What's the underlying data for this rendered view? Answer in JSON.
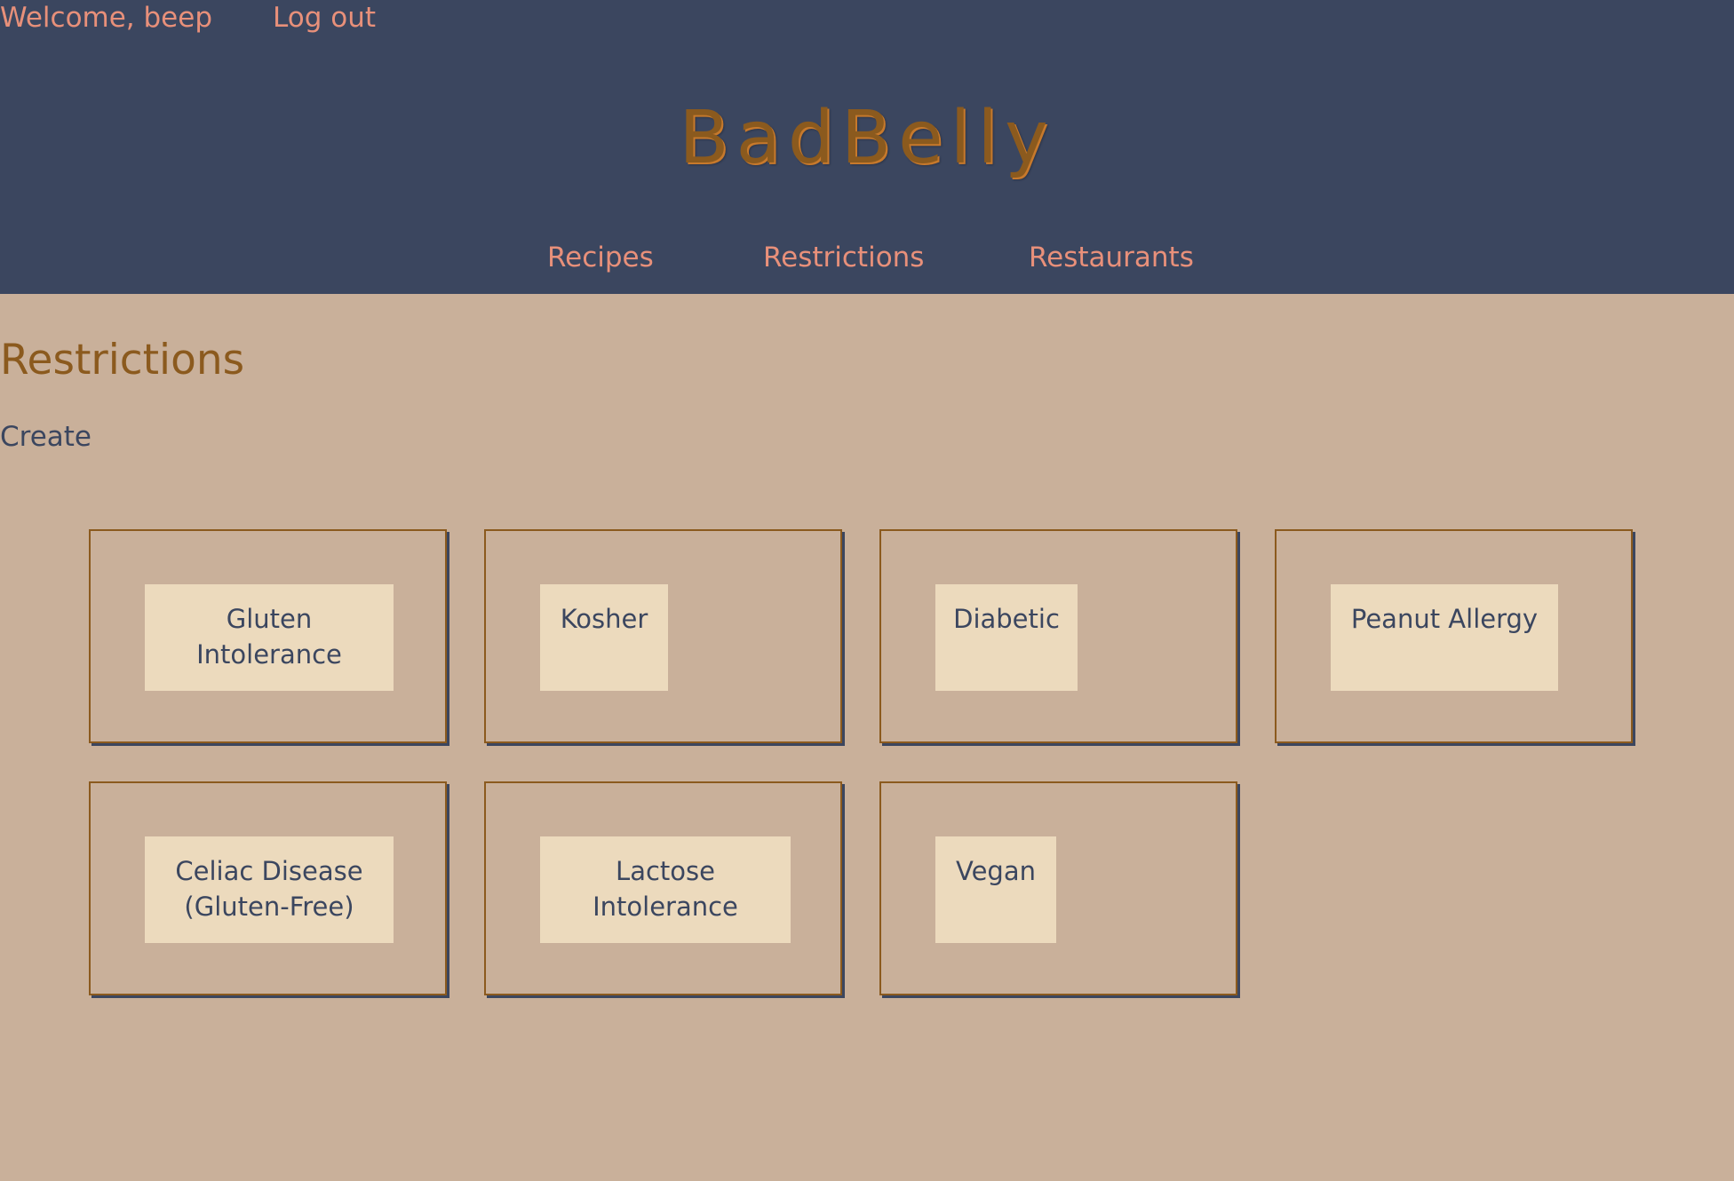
{
  "header": {
    "welcome_text": "Welcome, beep",
    "logout_label": "Log out",
    "brand": "BadBelly"
  },
  "nav": {
    "items": [
      {
        "label": "Recipes"
      },
      {
        "label": "Restrictions"
      },
      {
        "label": "Restaurants"
      }
    ]
  },
  "main": {
    "title": "Restrictions",
    "create_label": "Create",
    "restrictions": [
      {
        "line1": "Gluten",
        "line2": "Intolerance"
      },
      {
        "line1": "Kosher",
        "line2": ""
      },
      {
        "line1": "Diabetic",
        "line2": ""
      },
      {
        "line1": "Peanut Allergy",
        "line2": ""
      },
      {
        "line1": "Celiac Disease",
        "line2": "(Gluten-Free)"
      },
      {
        "line1": "Lactose",
        "line2": "Intolerance"
      },
      {
        "line1": "Vegan",
        "line2": ""
      }
    ]
  },
  "colors": {
    "header_bg": "#3b465f",
    "page_bg": "#c9b09a",
    "accent_salmon": "#e8907a",
    "brand_brown": "#8b5a1e",
    "label_bg": "#ecdabd"
  }
}
